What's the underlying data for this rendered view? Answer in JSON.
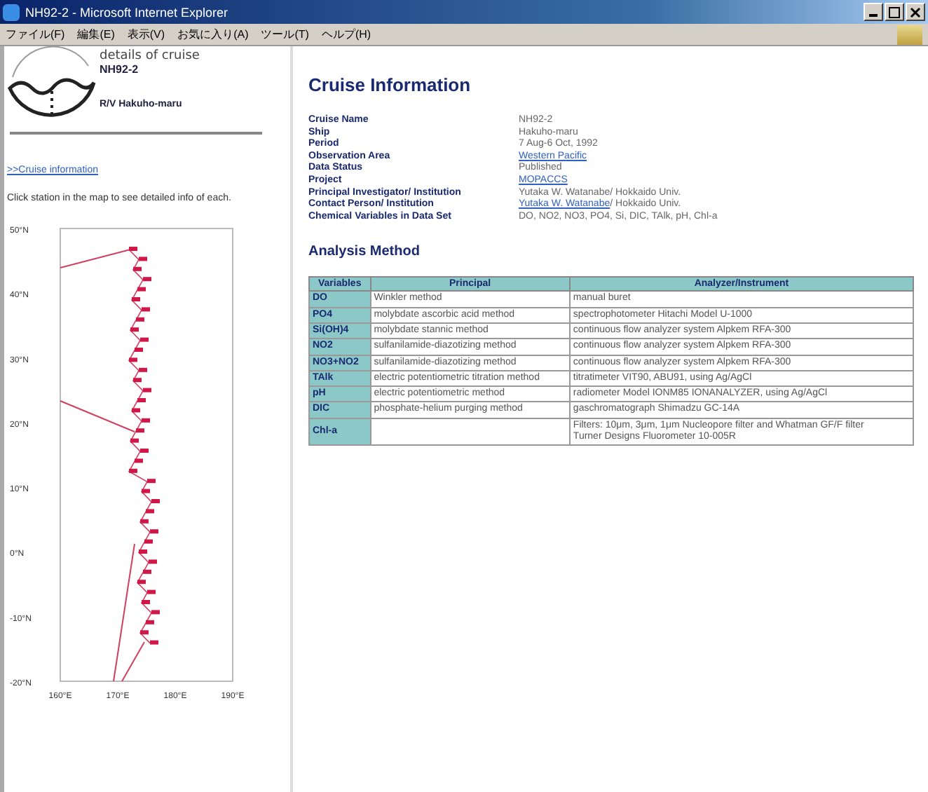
{
  "window": {
    "title": "NH92-2 - Microsoft Internet Explorer"
  },
  "menu": [
    "ファイル(F)",
    "編集(E)",
    "表示(V)",
    "お気に入り(A)",
    "ツール(T)",
    "ヘルプ(H)"
  ],
  "sidebar": {
    "heading": "details of cruise",
    "cruise": "NH92-2",
    "ship": "R/V Hakuho-maru",
    "link": ">>Cruise information",
    "hint": "Click station in the map to see detailed info of each.",
    "map": {
      "yticks": [
        "50°N",
        "40°N",
        "30°N",
        "20°N",
        "10°N",
        "0°N",
        "-10°N",
        "-20°N"
      ],
      "xticks": [
        "160°E",
        "170°E",
        "180°E",
        "190°E"
      ]
    }
  },
  "title": "Cruise Information",
  "info": [
    {
      "label": "Cruise Name",
      "value": "NH92-2",
      "kind": "text"
    },
    {
      "label": "Ship",
      "value": "Hakuho-maru",
      "kind": "text"
    },
    {
      "label": "Period",
      "value": "7 Aug-6 Oct, 1992",
      "kind": "text"
    },
    {
      "label": "Observation Area",
      "value": "Western Pacific",
      "kind": "link"
    },
    {
      "label": "Data Status",
      "value": "Published",
      "kind": "text"
    },
    {
      "label": "Project",
      "value": "MOPACCS",
      "kind": "link"
    },
    {
      "label": "Principal Investigator/ Institution",
      "value": "Yutaka W. Watanabe/ Hokkaido Univ.",
      "kind": "text"
    },
    {
      "label": "Contact Person/ Institution",
      "value": "Yutaka W. Watanabe",
      "suffix": "/ Hokkaido Univ.",
      "kind": "link"
    },
    {
      "label": "Chemical Variables in Data Set",
      "value": "DO, NO2, NO3, PO4, Si, DIC, TAlk, pH, Chl-a",
      "kind": "text"
    }
  ],
  "analysis": {
    "heading": "Analysis Method",
    "columns": [
      "Variables",
      "Principal",
      "Analyzer/Instrument"
    ],
    "rows": [
      [
        "DO",
        "Winkler method",
        "manual buret"
      ],
      [
        "PO4",
        "molybdate ascorbic acid method",
        "spectrophotometer Hitachi Model U-1000"
      ],
      [
        "Si(OH)4",
        "molybdate stannic method",
        "continuous flow analyzer system Alpkem RFA-300"
      ],
      [
        "NO2",
        "sulfanilamide-diazotizing method",
        "continuous flow analyzer system Alpkem RFA-300"
      ],
      [
        "NO3+NO2",
        "sulfanilamide-diazotizing method",
        "continuous flow analyzer system Alpkem RFA-300"
      ],
      [
        "TAlk",
        "electric potentiometric titration method",
        "titratimeter VIT90, ABU91, using Ag/AgCl"
      ],
      [
        "pH",
        "electric potentiometric method",
        "radiometer Model IONM85 IONANALYZER, using Ag/AgCl"
      ],
      [
        "DIC",
        "phosphate-helium purging method",
        "gaschromatograph Shimadzu GC-14A"
      ],
      [
        "Chl-a",
        "",
        "Filters: 10μm, 3μm, 1μm Nucleopore filter and Whatman GF/F filter\nTurner Designs Fluorometer 10-005R"
      ]
    ]
  }
}
